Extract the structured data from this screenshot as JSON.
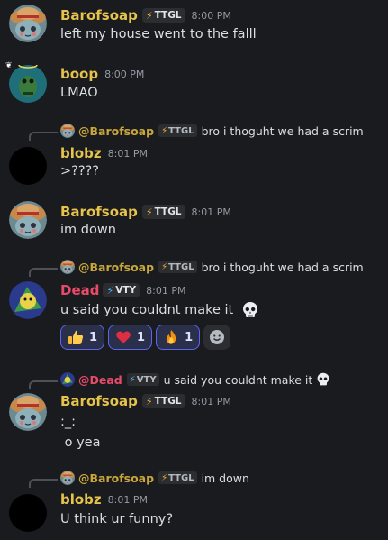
{
  "colors": {
    "barofsoap": "#e6c34a",
    "boop": "#e6c34a",
    "blobz": "#e6c34a",
    "dead": "#e84a6a",
    "mention_dead": "#e84a6a",
    "background": "#1a1b1f"
  },
  "messages": [
    {
      "author": "Barofsoap",
      "tag": "TTGL",
      "time": "8:00 PM",
      "text": "left my house went to the falll"
    },
    {
      "author": "boop",
      "time": "8:00 PM",
      "text": "LMAO"
    },
    {
      "reply": {
        "mention": "@Barofsoap",
        "tag": "TTGL",
        "text": "bro i thoguht we had a scrim"
      },
      "author": "blobz",
      "time": "8:01 PM",
      "text": ">????"
    },
    {
      "author": "Barofsoap",
      "tag": "TTGL",
      "time": "8:01 PM",
      "text": "im down"
    },
    {
      "reply": {
        "mention": "@Barofsoap",
        "tag": "TTGL",
        "text": "bro i thoguht we had a scrim"
      },
      "author": "Dead",
      "tag": "VTY",
      "time": "8:01 PM",
      "text": "u said you couldnt make it",
      "reactions": [
        {
          "emoji": "thumbs-up",
          "count": "1"
        },
        {
          "emoji": "heart",
          "count": "1"
        },
        {
          "emoji": "fire",
          "count": "1"
        }
      ]
    },
    {
      "reply": {
        "mention": "@Dead",
        "tag": "VTY",
        "text": "u said you couldnt make it"
      },
      "author": "Barofsoap",
      "tag": "TTGL",
      "time": "8:01 PM",
      "lines": [
        ":_:",
        " o yea"
      ]
    },
    {
      "reply": {
        "mention": "@Barofsoap",
        "tag": "TTGL",
        "text": "im down"
      },
      "author": "blobz",
      "time": "8:01 PM",
      "text": "U think ur funny?"
    }
  ]
}
